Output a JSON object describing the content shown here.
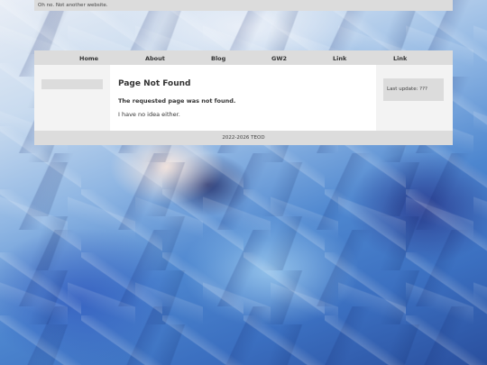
{
  "topbar": {
    "text": "Oh no. Not another website."
  },
  "nav": {
    "items": [
      {
        "label": "Home"
      },
      {
        "label": "About"
      },
      {
        "label": "Blog"
      },
      {
        "label": "GW2"
      },
      {
        "label": "Link"
      },
      {
        "label": "Link"
      }
    ]
  },
  "main": {
    "title": "Page Not Found",
    "message": "The requested page was not found.",
    "note": "I have no idea either."
  },
  "aside": {
    "last_update": "Last update: ???"
  },
  "footer": {
    "text": "2022-2026 TEOD"
  }
}
